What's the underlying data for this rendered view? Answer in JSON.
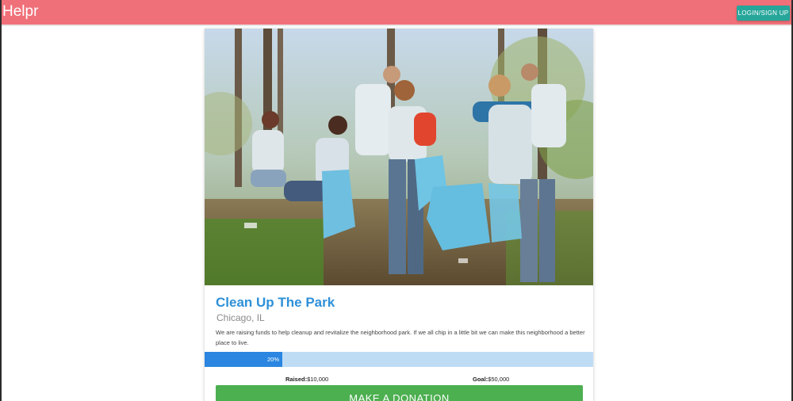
{
  "navbar": {
    "brand": "Helpr",
    "login_label": "LOGIN/SIGN UP"
  },
  "campaign": {
    "title": "Clean Up The Park",
    "location": "Chicago, IL",
    "description": "We are raising funds to help cleanup and revitalize the neighborhood park. If we all chip in a little bit we can make this neighborhood a better place to live.",
    "progress": {
      "percent": 20,
      "label": "20%"
    },
    "raised_label": "Raised:",
    "raised_value": "$10,000",
    "goal_label": "Goal:",
    "goal_value": "$50,000",
    "donate_label": "MAKE A DONATION"
  },
  "colors": {
    "navbar": "#f07079",
    "login_button": "#26a69a",
    "title": "#2e90d8",
    "progress_fill": "#2a86e0",
    "progress_track": "#bfdcf5",
    "donate_button": "#4caf50"
  }
}
